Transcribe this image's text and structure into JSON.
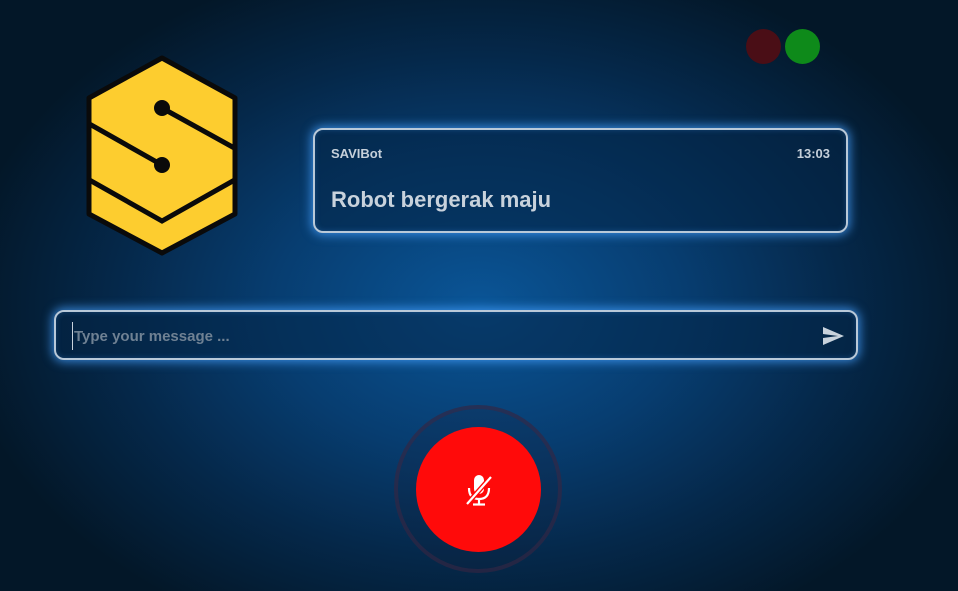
{
  "status_indicators": [
    {
      "name": "red",
      "color": "#4a0e16"
    },
    {
      "name": "green",
      "color": "#0e8a1a"
    }
  ],
  "logo": {
    "icon": "savibot-hexagon-logo-icon",
    "color": "#fdcd2f"
  },
  "chat": {
    "sender": "SAVIBot",
    "time": "13:03",
    "message": "Robot bergerak maju"
  },
  "input": {
    "value": "",
    "placeholder": "Type your message ...",
    "send_icon": "send-icon"
  },
  "mic": {
    "state": "muted",
    "icon": "microphone-off-icon",
    "color": "#ff0a0a"
  }
}
